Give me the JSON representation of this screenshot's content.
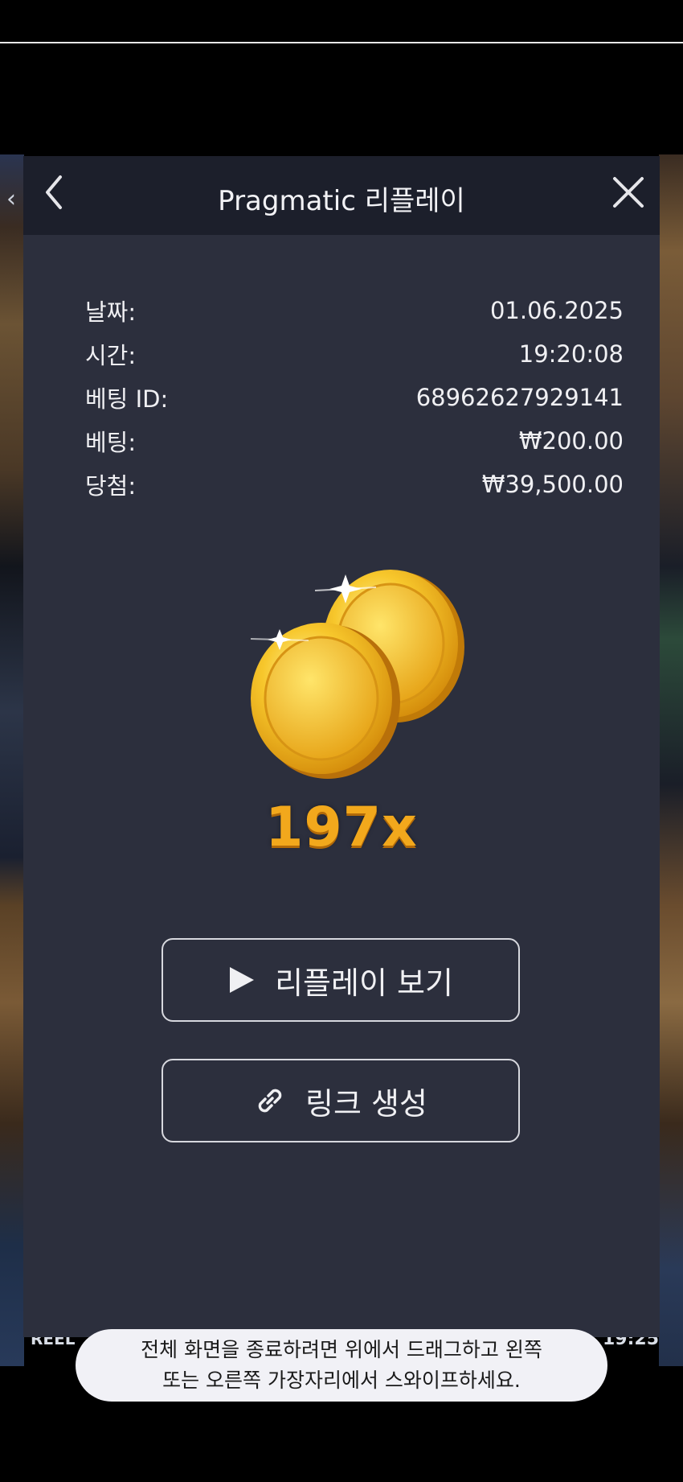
{
  "background": {
    "reel_text": "REEL",
    "clock_text": "19:25",
    "chevron": "‹"
  },
  "header": {
    "title": "Pragmatic 리플레이",
    "back_icon": "chevron-left-icon",
    "close_icon": "close-icon"
  },
  "details": [
    {
      "label": "날짜:",
      "value": "01.06.2025"
    },
    {
      "label": "시간:",
      "value": "19:20:08"
    },
    {
      "label": "베팅 ID:",
      "value": "68962627929141"
    },
    {
      "label": "베팅:",
      "value": "₩200.00"
    },
    {
      "label": "당첨:",
      "value": "₩39,500.00"
    }
  ],
  "win": {
    "image": "gold-coins-icon",
    "multiplier": "197x"
  },
  "buttons": {
    "replay_label": "리플레이 보기",
    "replay_icon": "play-icon",
    "link_label": "링크 생성",
    "link_icon": "link-icon"
  },
  "toast": {
    "line1": "전체 화면을 종료하려면 위에서 드래그하고 왼쪽",
    "line2": "또는 오른쪽 가장자리에서 스와이프하세요."
  },
  "colors": {
    "panel": "#2c2f3d",
    "header": "#1c1f2b",
    "multiplier": "#f2a81c",
    "coin": "#f6c12a"
  }
}
